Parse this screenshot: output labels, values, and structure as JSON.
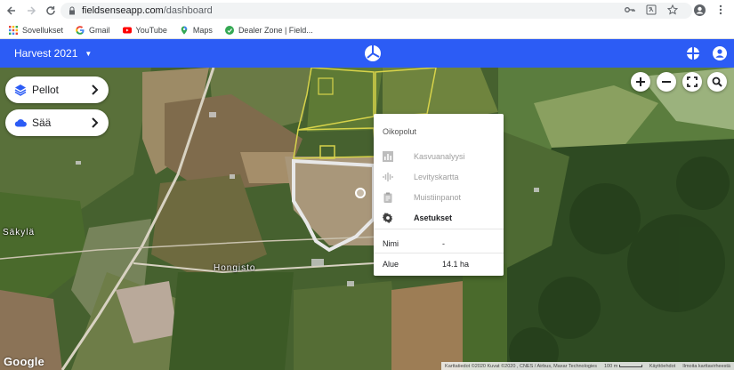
{
  "browser": {
    "url_host": "fieldsenseapp.com",
    "url_path": "/dashboard",
    "bookmarks": [
      {
        "label": "Sovellukset",
        "icon": "apps-grid-icon"
      },
      {
        "label": "Gmail",
        "icon": "google-icon"
      },
      {
        "label": "YouTube",
        "icon": "youtube-icon"
      },
      {
        "label": "Maps",
        "icon": "maps-icon"
      },
      {
        "label": "Dealer Zone | Field...",
        "icon": "dealer-zone-icon"
      }
    ]
  },
  "appbar": {
    "season": "Harvest 2021",
    "accent_color": "#2c5cf5"
  },
  "panels": {
    "fields_label": "Pellot",
    "weather_label": "Sää"
  },
  "map": {
    "place_labels": [
      "Säkylä",
      "Hongisto"
    ],
    "provider_logo": "Google",
    "attribution": {
      "data": "Karttatiedot ©2020 Kuvat ©2020 , CNES / Airbus, Maxar Technologies",
      "scale": "100 m",
      "terms": "Käyttöehdot",
      "report": "Ilmoita karttavirheestä"
    }
  },
  "popup": {
    "title": "Oikopolut",
    "items": [
      {
        "label": "Kasvuanalyysi",
        "icon": "bar-chart-icon",
        "enabled": false
      },
      {
        "label": "Levityskartta",
        "icon": "spread-map-icon",
        "enabled": false
      },
      {
        "label": "Muistiinpanot",
        "icon": "clipboard-icon",
        "enabled": false
      },
      {
        "label": "Asetukset",
        "icon": "gear-icon",
        "enabled": true
      }
    ],
    "info": [
      {
        "key": "Nimi",
        "value": "-"
      },
      {
        "key": "Alue",
        "value": "14.1 ha"
      }
    ]
  }
}
